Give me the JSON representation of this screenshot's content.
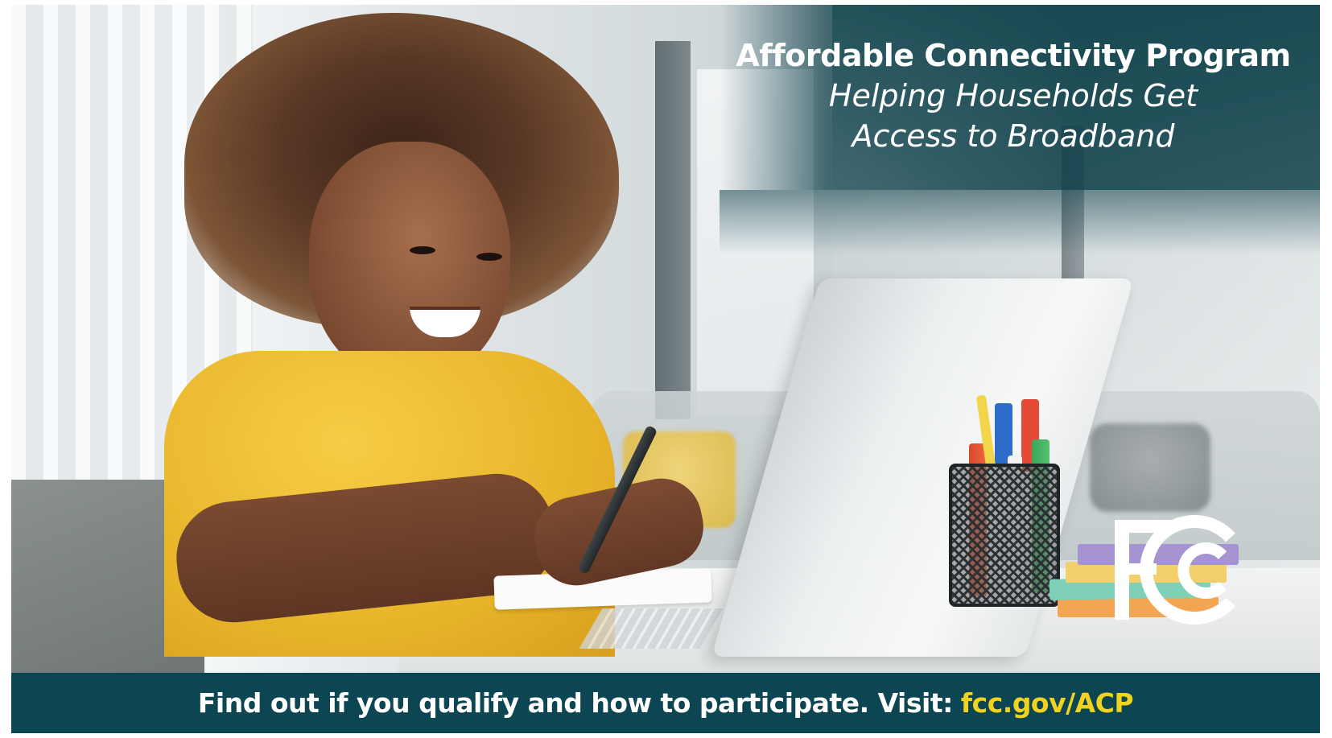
{
  "header": {
    "program_name": "Affordable Connectivity Program",
    "tagline_line1": "Helping Households Get",
    "tagline_line2": "Access to Broadband"
  },
  "logo": {
    "text": "FCC",
    "icon": "fcc-logo-icon"
  },
  "footer": {
    "message": "Find out if you qualify and how to participate. Visit:",
    "link_text": "fcc.gov/ACP"
  },
  "colors": {
    "footer_background": "#0c4652",
    "link": "#f3d21f",
    "title_text": "#ffffff"
  }
}
